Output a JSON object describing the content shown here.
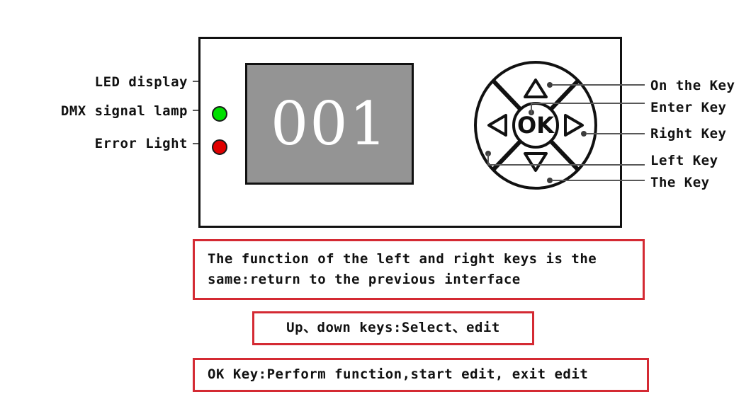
{
  "device": {
    "display": {
      "name": "LED display",
      "value": "001"
    },
    "lamps": [
      {
        "name": "DMX signal lamp",
        "color": "#00e000"
      },
      {
        "name": "Error Light",
        "color": "#e00000"
      }
    ],
    "keypad": {
      "center_label": "OK",
      "up_glyph": "▲",
      "down_glyph": "▼",
      "left_glyph": "◀",
      "right_glyph": "▶"
    }
  },
  "callouts": {
    "left": [
      {
        "label": "LED display"
      },
      {
        "label": "DMX signal lamp"
      },
      {
        "label": "Error Light"
      }
    ],
    "right": [
      {
        "label": "On the Key"
      },
      {
        "label": "Enter Key"
      },
      {
        "label": "Right Key"
      },
      {
        "label": "Left Key"
      },
      {
        "label": "The Key"
      }
    ]
  },
  "notes": [
    {
      "lines": [
        "The function of the left and right keys is the",
        "same:return to the previous interface"
      ]
    },
    {
      "lines": [
        "Up、down keys:Select、edit"
      ]
    },
    {
      "lines": [
        "OK Key:Perform function,start edit, exit edit"
      ]
    }
  ],
  "colors": {
    "note_border": "#d42a33",
    "panel_border": "#111111",
    "screen_bg": "#949494",
    "leader": "#585858"
  }
}
